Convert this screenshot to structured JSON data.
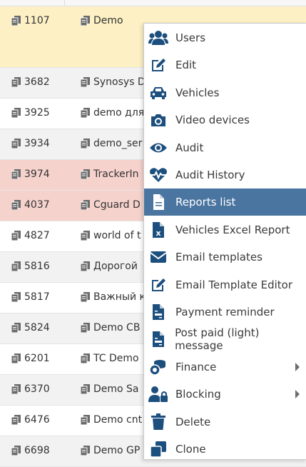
{
  "colors": {
    "icon": "#1d4f7e",
    "active_bg": "#4a75a0",
    "selected_row": "#fcf0c4",
    "alert_row": "#f6d2cd"
  },
  "rows": [
    {
      "id": "1107",
      "name": "Demo"
    },
    {
      "id": "3682",
      "name": "Synosys D"
    },
    {
      "id": "3925",
      "name": "demo для"
    },
    {
      "id": "3934",
      "name": "demo_ser"
    },
    {
      "id": "3974",
      "name": "TrackerIn"
    },
    {
      "id": "4037",
      "name": "Cguard D"
    },
    {
      "id": "4827",
      "name": "world of t"
    },
    {
      "id": "5816",
      "name": "Дорогой"
    },
    {
      "id": "5817",
      "name": "Важный к"
    },
    {
      "id": "5824",
      "name": "Demo CB"
    },
    {
      "id": "6201",
      "name": "TC Demo"
    },
    {
      "id": "6370",
      "name": "Demo Sa"
    },
    {
      "id": "6476",
      "name": "Demo cnt"
    },
    {
      "id": "6698",
      "name": "Demo GP"
    }
  ],
  "menu": [
    {
      "label": "Users",
      "icon": "users-icon"
    },
    {
      "label": "Edit",
      "icon": "edit-icon"
    },
    {
      "label": "Vehicles",
      "icon": "car-icon"
    },
    {
      "label": "Video devices",
      "icon": "camera-icon"
    },
    {
      "label": "Audit",
      "icon": "eye-icon"
    },
    {
      "label": "Audit History",
      "icon": "heartbeat-icon"
    },
    {
      "label": "Reports list",
      "icon": "file-icon"
    },
    {
      "label": "Vehicles Excel Report",
      "icon": "excel-icon"
    },
    {
      "label": "Email templates",
      "icon": "envelope-icon"
    },
    {
      "label": "Email Template Editor",
      "icon": "edit-icon"
    },
    {
      "label": "Payment reminder",
      "icon": "invoice-icon"
    },
    {
      "label": "Post paid (light) message",
      "icon": "invoice-icon"
    },
    {
      "label": "Finance",
      "icon": "coins-icon"
    },
    {
      "label": "Blocking",
      "icon": "user-lock-icon"
    },
    {
      "label": "Delete",
      "icon": "trash-icon"
    },
    {
      "label": "Clone",
      "icon": "clone-icon"
    }
  ]
}
